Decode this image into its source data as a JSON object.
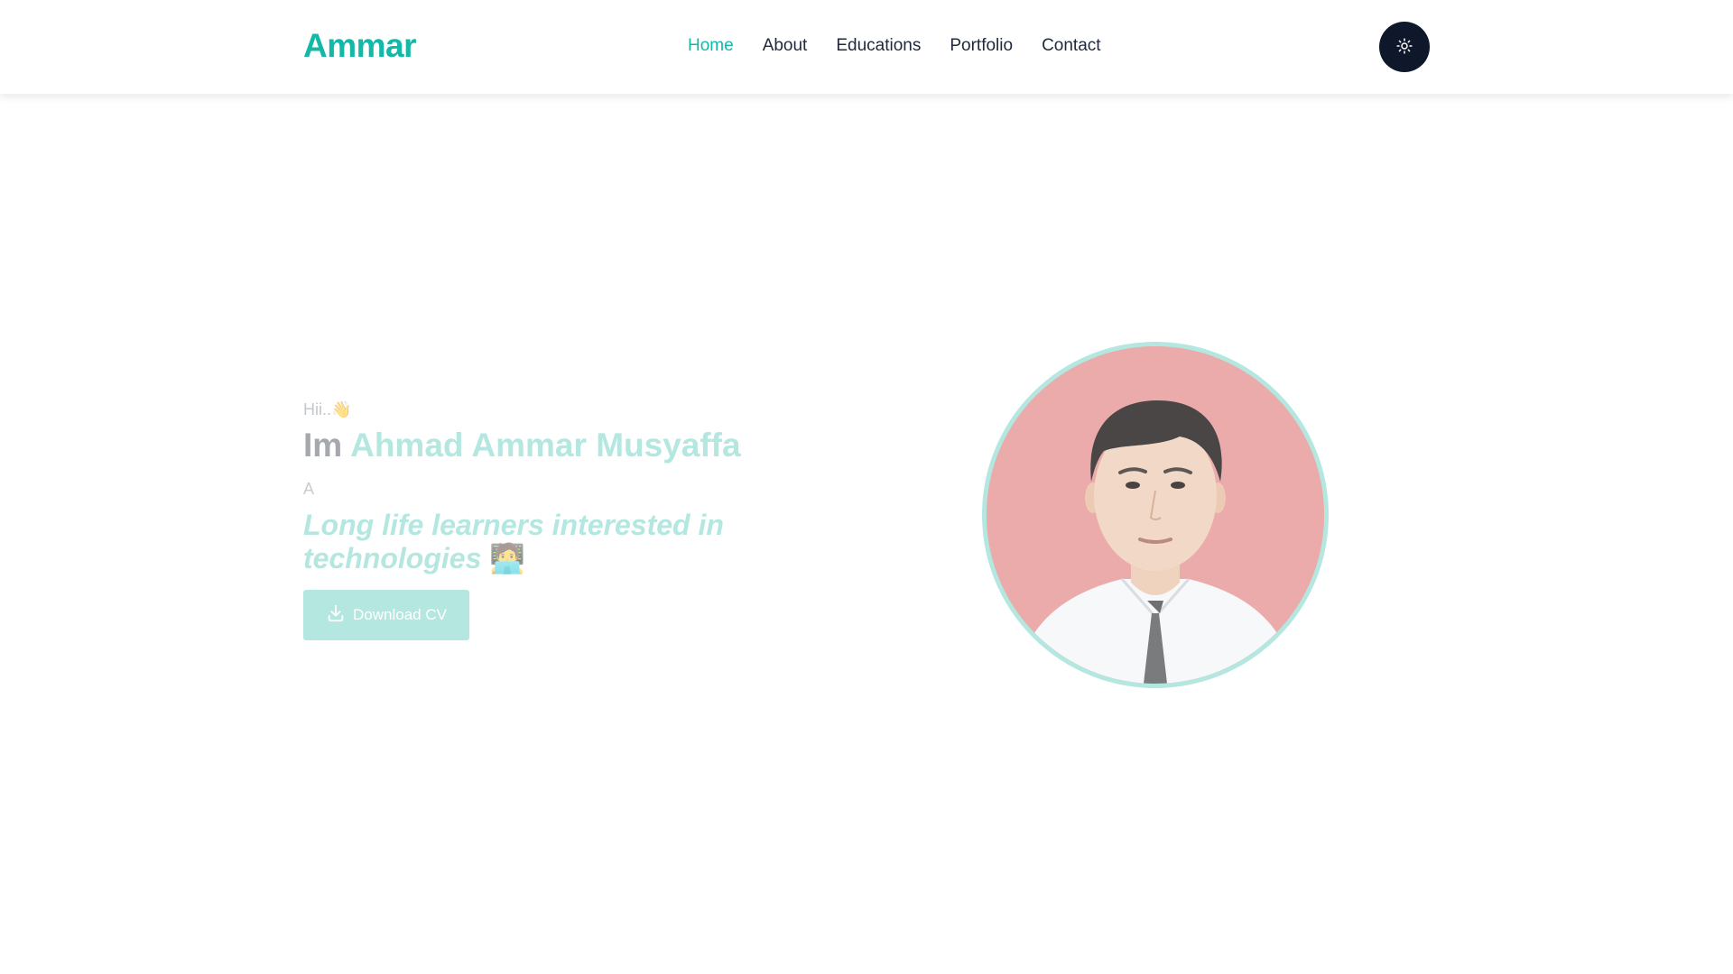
{
  "brand": "Ammar",
  "nav": {
    "items": [
      {
        "label": "Home",
        "active": true
      },
      {
        "label": "About",
        "active": false
      },
      {
        "label": "Educations",
        "active": false
      },
      {
        "label": "Portfolio",
        "active": false
      },
      {
        "label": "Contact",
        "active": false
      }
    ]
  },
  "theme_toggle": {
    "icon": "sun-icon"
  },
  "hero": {
    "greeting": "Hii..",
    "greeting_emoji": "👋",
    "im": "Im",
    "name": "Ahmad Ammar Musyaffa",
    "role_prefix": "A",
    "tagline": "Long life learners interested in technologies",
    "tagline_emoji": "🧑‍💻",
    "download_label": "Download CV",
    "download_icon": "download-icon"
  },
  "colors": {
    "accent": "#14b8a6",
    "accent_faded": "#b3e7e0",
    "dark": "#0f172a",
    "photo_bg": "#ebabab"
  }
}
